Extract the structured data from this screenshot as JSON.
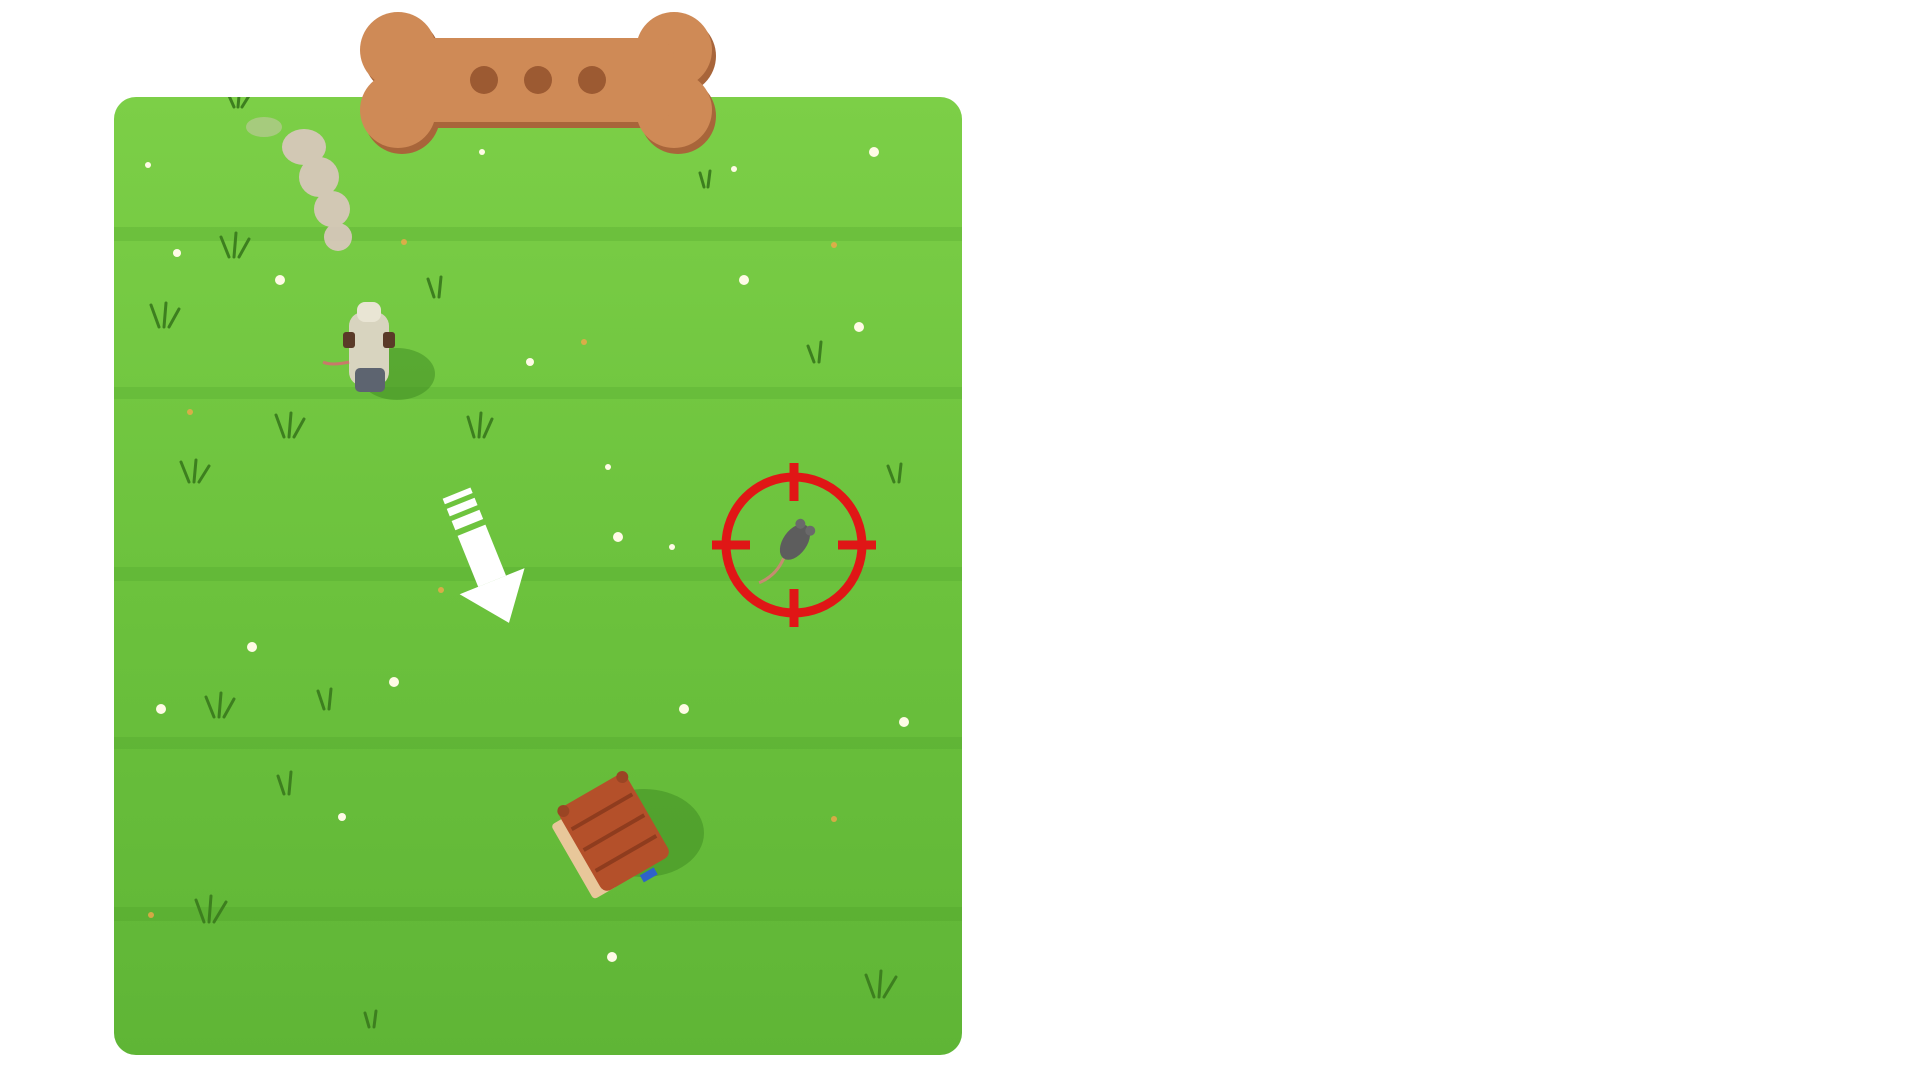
{
  "game": {
    "scene": "grass-field",
    "colors": {
      "grass_light": "#7ccf47",
      "grass_mid": "#63bb38",
      "grass_dark": "#4e9e2a",
      "bone": "#cf8a56",
      "bone_shadow": "#a8653a",
      "bone_dots": "#9c5a32",
      "crosshair": "#e01616",
      "arrow": "#ffffff",
      "doghouse_roof": "#b4502a",
      "smoke": "#e2c8c8"
    },
    "menu_button": {
      "icon": "bone-icon",
      "dots": 3
    },
    "player": {
      "icon": "backpack-character-icon"
    },
    "target": {
      "icon": "crosshair-icon",
      "creature": "rat-icon"
    },
    "hint_arrow": {
      "icon": "arrow-down-right-icon"
    },
    "goal": {
      "icon": "doghouse-icon"
    }
  }
}
